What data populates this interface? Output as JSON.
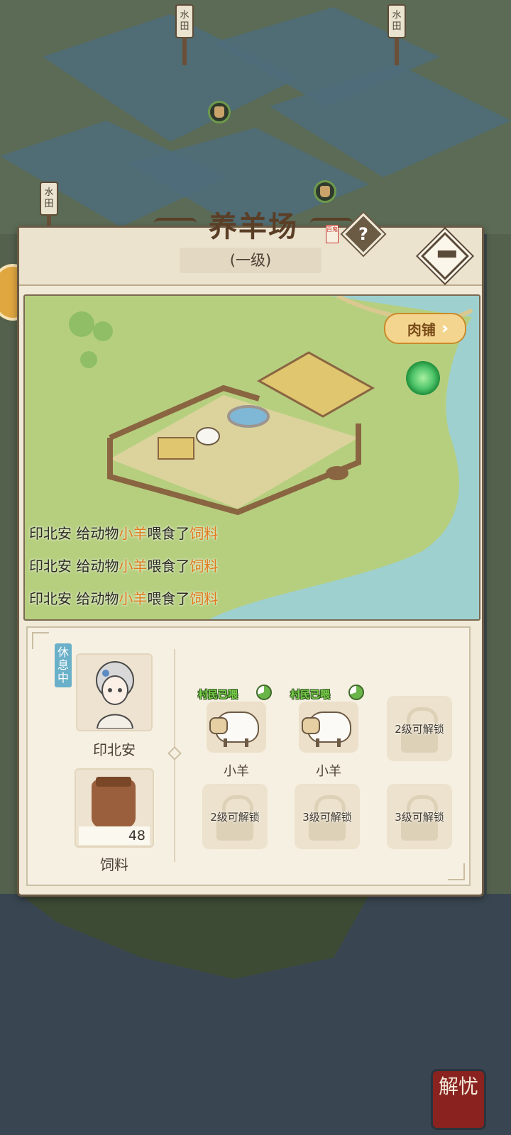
{
  "background": {
    "signs": [
      "水田",
      "水田",
      "水田"
    ]
  },
  "panel": {
    "title": "养羊场",
    "seal_text": "百鬼",
    "level": "(一级)",
    "help_label": "?",
    "scene": {
      "meat_shop_button": "肉铺",
      "log": [
        {
          "actor": "印北安",
          "verb": "给动物",
          "animal": "小羊",
          "action": "喂食了",
          "item": "饲料"
        },
        {
          "actor": "印北安",
          "verb": "给动物",
          "animal": "小羊",
          "action": "喂食了",
          "item": "饲料"
        },
        {
          "actor": "印北安",
          "verb": "给动物",
          "animal": "小羊",
          "action": "喂食了",
          "item": "饲料"
        }
      ]
    },
    "worker": {
      "status": "休息中",
      "name": "印北安"
    },
    "feed": {
      "name": "饲料",
      "count": "48"
    },
    "animals": [
      {
        "badge": "村民已喂",
        "name": "小羊"
      },
      {
        "badge": "村民已喂",
        "name": "小羊"
      }
    ],
    "locked": [
      "2级可解锁",
      "2级可解锁",
      "3级可解锁",
      "3级可解锁"
    ]
  },
  "corner_button": "解忧"
}
